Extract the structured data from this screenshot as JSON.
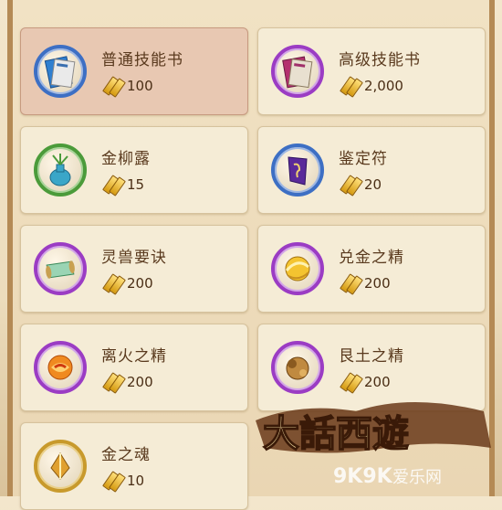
{
  "items": [
    {
      "name": "普通技能书",
      "price": "100",
      "icon": "skill-book-blue-icon",
      "ring": "blue",
      "selected": true
    },
    {
      "name": "高级技能书",
      "price": "2,000",
      "icon": "skill-book-purple-icon",
      "ring": "purple",
      "selected": false
    },
    {
      "name": "金柳露",
      "price": "15",
      "icon": "vase-icon",
      "ring": "green",
      "selected": false
    },
    {
      "name": "鉴定符",
      "price": "20",
      "icon": "talisman-icon",
      "ring": "blue",
      "selected": false
    },
    {
      "name": "灵兽要诀",
      "price": "200",
      "icon": "scroll-icon",
      "ring": "purple",
      "selected": false
    },
    {
      "name": "兑金之精",
      "price": "200",
      "icon": "gold-essence-icon",
      "ring": "purple",
      "selected": false
    },
    {
      "name": "离火之精",
      "price": "200",
      "icon": "fire-essence-icon",
      "ring": "purple",
      "selected": false
    },
    {
      "name": "艮土之精",
      "price": "200",
      "icon": "earth-essence-icon",
      "ring": "purple",
      "selected": false
    },
    {
      "name": "金之魂",
      "price": "10",
      "icon": "gold-soul-icon",
      "ring": "gold",
      "selected": false
    }
  ],
  "watermark": {
    "title": "大话西游",
    "site": "9K9K",
    "site_cn": "爱乐网"
  }
}
